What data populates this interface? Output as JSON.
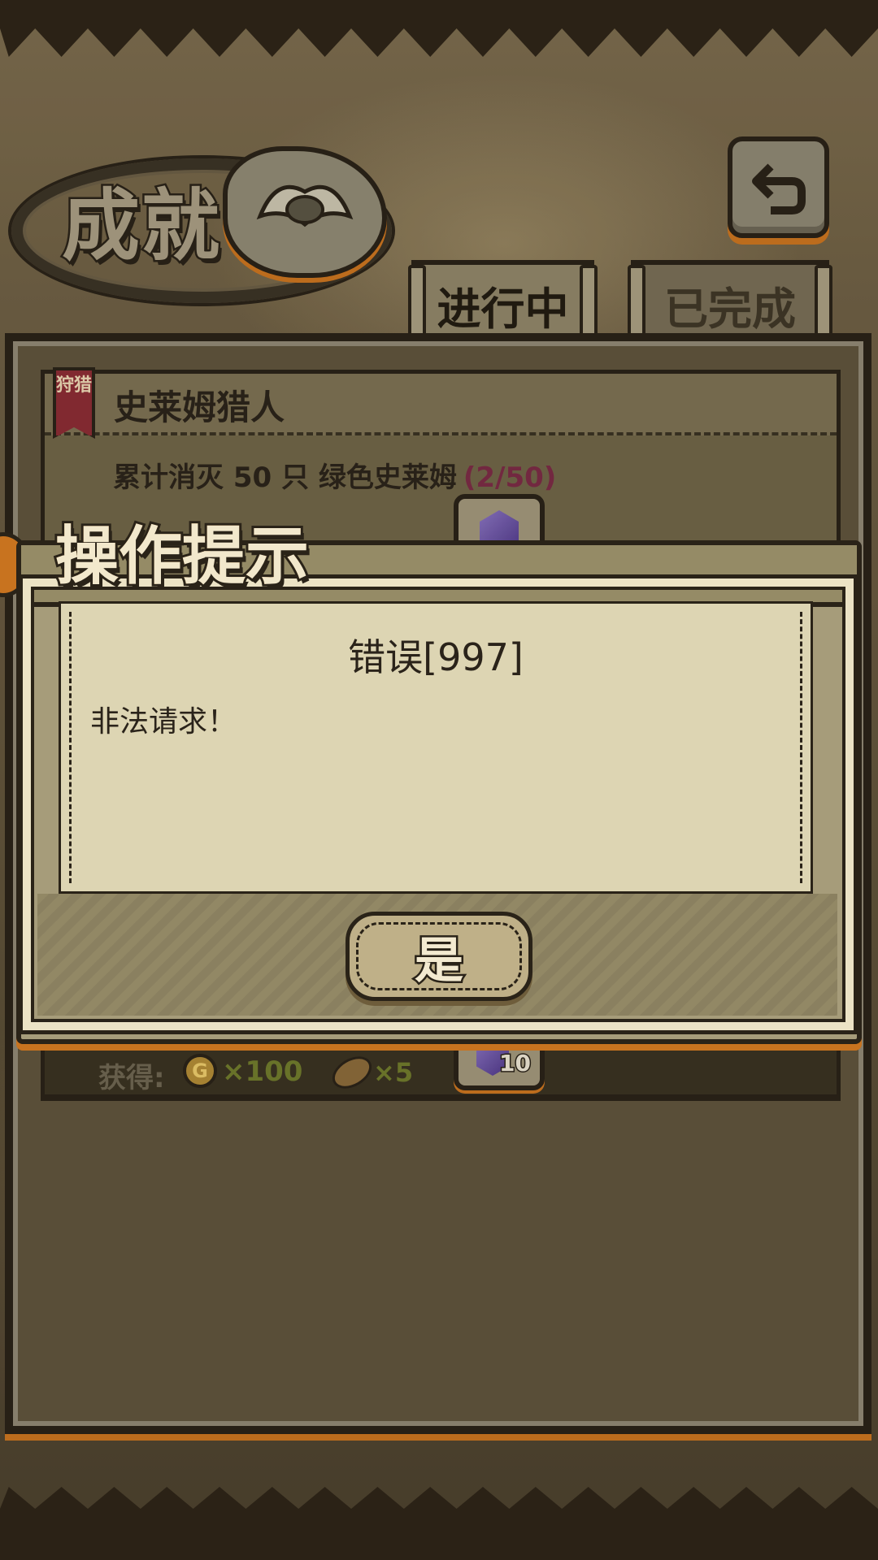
{
  "header": {
    "title": "成就"
  },
  "tabs": [
    {
      "label": "进行中",
      "active": true
    },
    {
      "label": "已完成",
      "active": false
    }
  ],
  "achievement": {
    "category_badge": "狩猎",
    "name": "史莱姆猎人",
    "description": "累计消灭 50 只 绿色史莱姆",
    "progress": "(2/50)",
    "reward_label": "获得:",
    "coin_icon_text": "G",
    "coin_reward": "×100",
    "bread_reward": "×5",
    "gem_count": "10"
  },
  "dialog": {
    "title": "操作提示",
    "message_title": "错误[997]",
    "message_body": "非法请求！",
    "confirm_label": "是"
  },
  "colors": {
    "accent_orange": "#c8731f",
    "progress_text": "#7a2b44",
    "reward_text": "#6f7a2c",
    "gem_purple": "#6a52a8"
  }
}
